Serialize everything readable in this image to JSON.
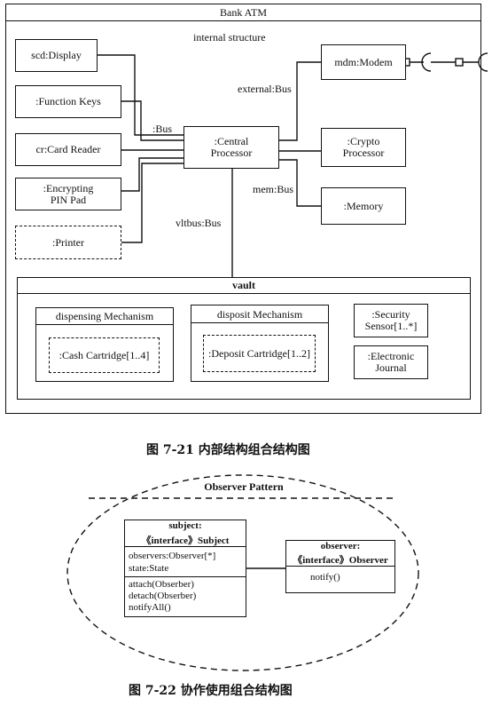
{
  "fig1": {
    "title": "Bank ATM",
    "subtitle": "internal structure",
    "parts": {
      "display": "scd:Display",
      "function_keys": ":Function Keys",
      "card_reader": "cr:Card Reader",
      "pin_pad": ":Encrypting\nPIN Pad",
      "printer": ":Printer",
      "cpu": ":Central\nProcessor",
      "modem": "mdm:Modem",
      "crypto": ":Crypto\nProcessor",
      "memory": ":Memory"
    },
    "connectors": {
      "bus": ":Bus",
      "external": "external:Bus",
      "mem": "mem:Bus",
      "vltbus": "vltbus:Bus"
    },
    "vault": {
      "title": "vault",
      "dispensing_title": "dispensing Mechanism",
      "cash": ":Cash Cartridge[1..4]",
      "deposit_title": "disposit Mechanism",
      "deposit": ":Deposit Cartridge[1..2]",
      "sensor": ":Security\nSensor[1..*]",
      "journal": ":Electronic\nJournal"
    },
    "caption": "图 7-21    内部结构组合结构图"
  },
  "fig2": {
    "title": "Observer Pattern",
    "subject": {
      "header1": "subject:",
      "header2": "《interface》Subject",
      "attrs": [
        "observers:Observer[*]",
        "state:State"
      ],
      "ops": [
        "attach(Obserber)",
        "detach(Obserber)",
        "notifyAll()"
      ]
    },
    "observer": {
      "header1": "observer:",
      "header2": "《interface》Observer",
      "ops": [
        "notify()"
      ]
    },
    "caption": "图 7-22    协作使用组合结构图"
  }
}
